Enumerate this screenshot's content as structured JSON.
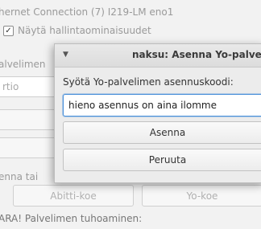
{
  "background": {
    "connection_text": "hernet Connection (7) I219-LM eno1",
    "show_admin_checkbox": {
      "checked": true,
      "label": "Näytä hallintaominaisuudet"
    },
    "partial_label_palvelimen": "alvelimen",
    "partial_field_value": "rtio",
    "partial_install_label": "enna tai",
    "abitti_button": "Abitti-koe",
    "yo_button": "Yo-koe",
    "warning_text": "ARA! Palvelimen tuhoaminen:"
  },
  "dialog": {
    "menu_icon": "triangle-down-icon",
    "title": "naksu: Asenna Yo-palvelin",
    "prompt": "Syötä Yo-palvelimen asennuskoodi:",
    "code_value": "hieno asennus on aina ilomme",
    "install_label": "Asenna",
    "cancel_label": "Peruuta"
  },
  "colors": {
    "focus_border": "#4a90d9",
    "background": "#f2f2f2",
    "dialog_background": "#ececec"
  }
}
